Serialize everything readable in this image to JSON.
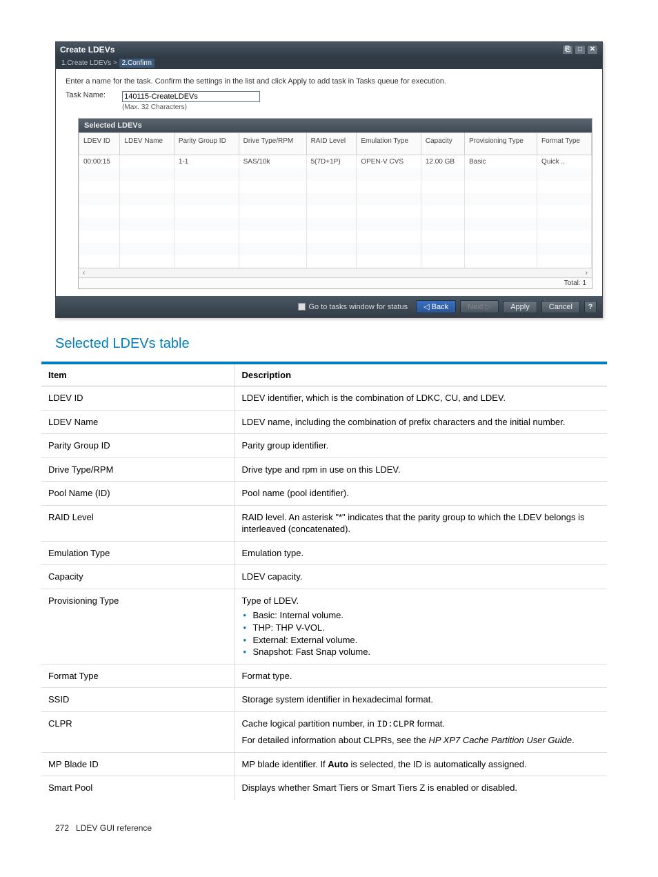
{
  "dialog": {
    "title": "Create LDEVs",
    "breadcrumb": {
      "step1": "1.Create LDEVs",
      "sep": ">",
      "step2": "2.Confirm"
    },
    "instruction": "Enter a name for the task. Confirm the settings in the list and click Apply to add task in Tasks queue for execution.",
    "taskNameLabel": "Task Name:",
    "taskNameValue": "140115-CreateLDEVs",
    "taskNameHint": "(Max. 32 Characters)",
    "panelTitle": "Selected LDEVs",
    "headers": {
      "c0": "LDEV ID",
      "c1": "LDEV Name",
      "c2": "Parity Group ID",
      "c3": "Drive Type/RPM",
      "c4": "RAID Level",
      "c5": "Emulation Type",
      "c6": "Capacity",
      "c7": "Provisioning Type",
      "c8": "Format Type"
    },
    "row": {
      "c0": "00:00:15",
      "c1": "",
      "c2": "1-1",
      "c3": "SAS/10k",
      "c4": "5(7D+1P)",
      "c5": "OPEN-V CVS",
      "c6": "12.00 GB",
      "c7": "Basic",
      "c8": "Quick .."
    },
    "totalLabel": "Total:  1",
    "footer": {
      "goToTasks": "Go to tasks window for status",
      "back": "Back",
      "next": "Next",
      "apply": "Apply",
      "cancel": "Cancel"
    }
  },
  "section": {
    "title": "Selected LDEVs table",
    "thItem": "Item",
    "thDesc": "Description",
    "rows": [
      {
        "item": "LDEV ID",
        "desc": "LDEV identifier, which is the combination of LDKC, CU, and LDEV."
      },
      {
        "item": "LDEV Name",
        "desc": "LDEV name, including the combination of prefix characters and the initial number."
      },
      {
        "item": "Parity Group ID",
        "desc": "Parity group identifier."
      },
      {
        "item": "Drive Type/RPM",
        "desc": "Drive type and rpm in use on this LDEV."
      },
      {
        "item": "Pool Name (ID)",
        "desc": "Pool name (pool identifier)."
      },
      {
        "item": "RAID Level",
        "desc": "RAID level. An asterisk \"*\" indicates that the parity group to which the LDEV belongs is interleaved (concatenated)."
      },
      {
        "item": "Emulation Type",
        "desc": "Emulation type."
      },
      {
        "item": "Capacity",
        "desc": "LDEV capacity."
      }
    ],
    "provisioning": {
      "item": "Provisioning Type",
      "lead": "Type of LDEV.",
      "bullets": [
        "Basic: Internal volume.",
        "THP: THP V-VOL.",
        "External: External volume.",
        "Snapshot: Fast Snap volume."
      ]
    },
    "tail": [
      {
        "item": "Format Type",
        "desc": "Format type."
      },
      {
        "item": "SSID",
        "desc": "Storage system identifier in hexadecimal format."
      }
    ],
    "clpr": {
      "item": "CLPR",
      "l1a": "Cache logical partition number, in ",
      "l1code": "ID:CLPR",
      "l1b": " format.",
      "l2a": "For detailed information about CLPRs, see the ",
      "l2i": "HP XP7 Cache Partition User Guide",
      "l2b": "."
    },
    "mp": {
      "item": "MP Blade ID",
      "a": "MP blade identifier. If ",
      "b": "Auto",
      "c": " is selected, the ID is automatically assigned."
    },
    "smart": {
      "item": "Smart Pool",
      "desc": "Displays whether Smart Tiers or Smart Tiers Z is enabled or disabled."
    }
  },
  "footerLine": {
    "page": "272",
    "title": "LDEV GUI reference"
  }
}
